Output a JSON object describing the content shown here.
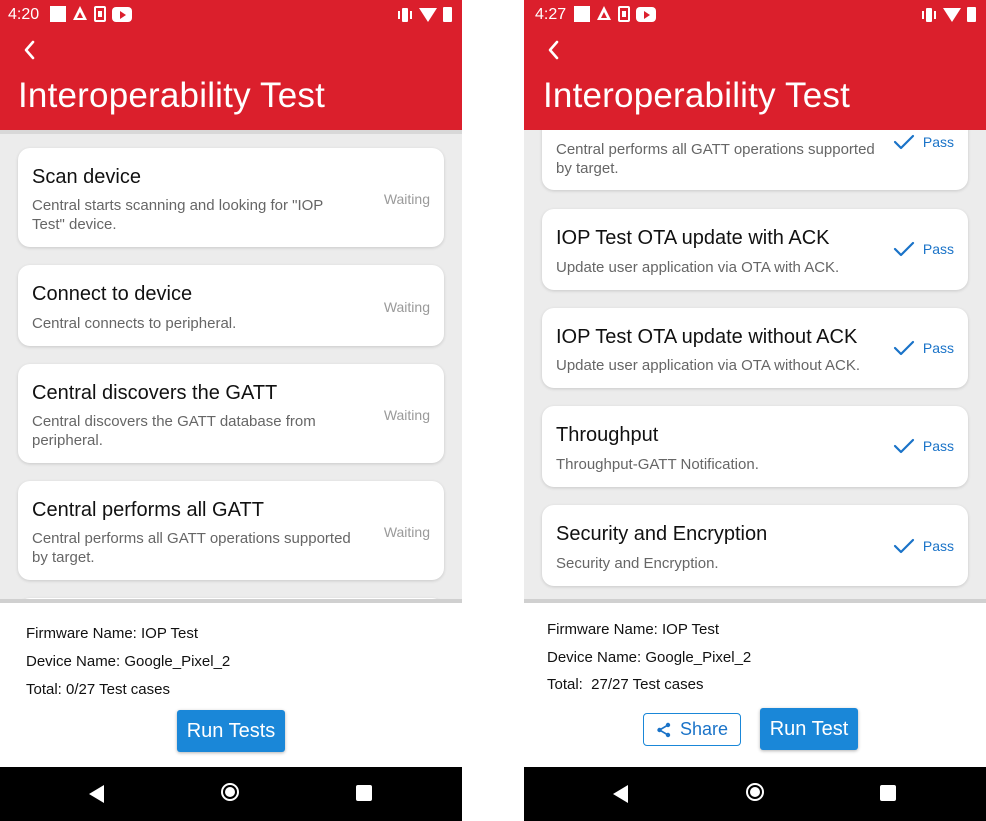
{
  "left": {
    "status": {
      "time": "4:20"
    },
    "title": "Interoperability Test",
    "tests": [
      {
        "title": "Scan device",
        "desc": "Central starts scanning and looking for \"IOP Test\" device.",
        "status": "Waiting"
      },
      {
        "title": "Connect to device",
        "desc": "Central connects to peripheral.",
        "status": "Waiting"
      },
      {
        "title": "Central discovers the GATT",
        "desc": "Central discovers the GATT database from peripheral.",
        "status": "Waiting"
      },
      {
        "title": "Central performs all GATT",
        "desc": "Central performs all GATT operations supported by target.",
        "status": "Waiting"
      }
    ],
    "info": {
      "firmware": "Firmware Name: IOP Test",
      "device": "Device Name: Google_Pixel_2",
      "total": "Total: 0/27 Test cases"
    },
    "run_button": "Run Tests"
  },
  "right": {
    "status": {
      "time": "4:27"
    },
    "title": "Interoperability Test",
    "tests": [
      {
        "title": "",
        "desc": "Central performs all GATT operations supported by target.",
        "status": "Pass"
      },
      {
        "title": "IOP Test OTA update with ACK",
        "desc": "Update user application via OTA with ACK.",
        "status": "Pass"
      },
      {
        "title": "IOP Test OTA update without ACK",
        "desc": "Update user application via OTA without ACK.",
        "status": "Pass"
      },
      {
        "title": "Throughput",
        "desc": "Throughput-GATT Notification.",
        "status": "Pass"
      },
      {
        "title": "Security and Encryption",
        "desc": "Security and Encryption.",
        "status": "Pass"
      }
    ],
    "info": {
      "firmware": "Firmware Name: IOP Test",
      "device": "Device Name: Google_Pixel_2",
      "total": "Total:  27/27 Test cases"
    },
    "share_button": "Share",
    "run_button": "Run Test"
  },
  "colors": {
    "accent": "#db1f2c",
    "button": "#1a87d8",
    "pass": "#1a73c8"
  },
  "icons": [
    "back-arrow-icon",
    "check-icon",
    "share-icon",
    "nav-back-icon",
    "nav-home-icon",
    "nav-recents-icon"
  ]
}
